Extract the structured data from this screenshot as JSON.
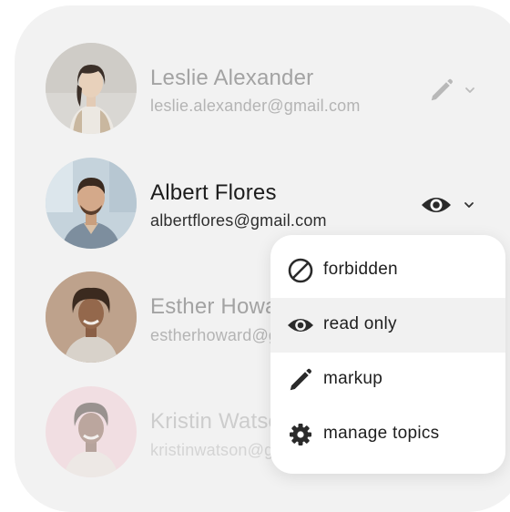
{
  "users": [
    {
      "name": "Leslie Alexander",
      "email": "leslie.alexander@gmail.com",
      "permission_icon": "pencil-icon"
    },
    {
      "name": "Albert Flores",
      "email": "albertflores@gmail.com",
      "permission_icon": "eye-icon"
    },
    {
      "name": "Esther Howard",
      "email": "estherhoward@gmail.com"
    },
    {
      "name": "Kristin Watson",
      "email": "kristinwatson@gmail.com"
    }
  ],
  "permission_menu": {
    "selected": "read only",
    "items": [
      {
        "label": "forbidden",
        "icon": "forbidden-icon"
      },
      {
        "label": "read only",
        "icon": "eye-icon"
      },
      {
        "label": "markup",
        "icon": "pencil-icon"
      },
      {
        "label": "manage topics",
        "icon": "gear-icon"
      }
    ]
  },
  "colors": {
    "card_background": "#f2f2f2",
    "menu_background": "#ffffff",
    "selected_item": "#f1f1f1",
    "active_text": "#1c1c1c"
  }
}
